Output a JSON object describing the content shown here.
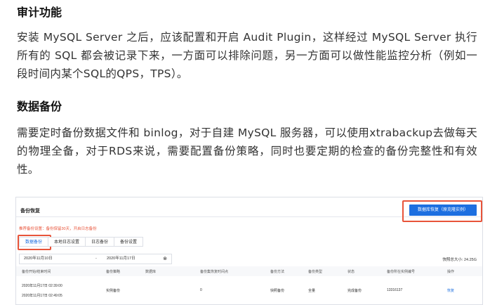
{
  "article": {
    "heading1": "审计功能",
    "para1": "安装 MySQL Server 之后，应该配置和开启 Audit Plugin，这样经过 MySQL Server 执行所有的 SQL 都会被记录下来，一方面可以排除问题，另一方面可以做性能监控分析（例如一段时间内某个SQL的QPS，TPS）。",
    "heading2": "数据备份",
    "para2": "需要定时备份数据文件和 binlog，对于自建 MySQL 服务器，可以使用xtrabackup去做每天的物理全备，对于RDS来说，需要配置备份策略，同时也要定期的检查的备份完整性和有效性。"
  },
  "console": {
    "page_title": "备份恢复",
    "restore_button": "数据库恢复（原克隆实例）",
    "policy_text": "推荐备份设置：备份保留30天，开启日志备份",
    "tabs": [
      {
        "label": "数据备份",
        "active": true
      },
      {
        "label": "本地日志设置",
        "active": false
      },
      {
        "label": "日志备份",
        "active": false
      },
      {
        "label": "备份设置",
        "active": false
      }
    ],
    "date_start": "2020年11月10日",
    "date_sep": "-",
    "date_end": "2020年11月17日",
    "quota": "快照总大小: 24.25G",
    "columns": [
      "备份开始/结束时间",
      "备份策略",
      "数据库",
      "备份集恢复时间点",
      "备份方法",
      "备份类型",
      "状态",
      "备份所在实例编号",
      "操作"
    ],
    "row": {
      "start": "2020年11月17日 02:39:00",
      "end": "2020年11月17日 02:49:05",
      "strategy": "实例备份",
      "database": "",
      "restore_point": "0",
      "method": "快照备份",
      "type": "全量",
      "status": "完成备份",
      "instance_id": "13316137",
      "action": "恢复"
    },
    "accent_color": "#1d6fe0",
    "highlight_color": "#e8543a"
  }
}
